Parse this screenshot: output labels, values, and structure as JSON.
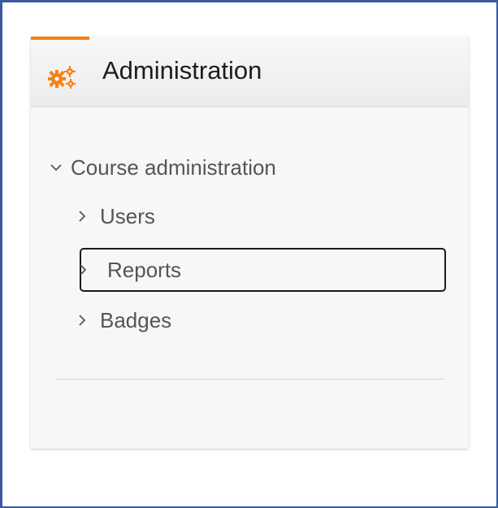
{
  "block": {
    "title": "Administration",
    "icon": "gears-icon",
    "accent_color": "#f98012"
  },
  "tree": {
    "course": {
      "label": "Course administration",
      "expanded": true
    },
    "items": [
      {
        "label": "Users",
        "expanded": false,
        "focused": false
      },
      {
        "label": "Reports",
        "expanded": false,
        "focused": true
      },
      {
        "label": "Badges",
        "expanded": false,
        "focused": false
      }
    ]
  }
}
